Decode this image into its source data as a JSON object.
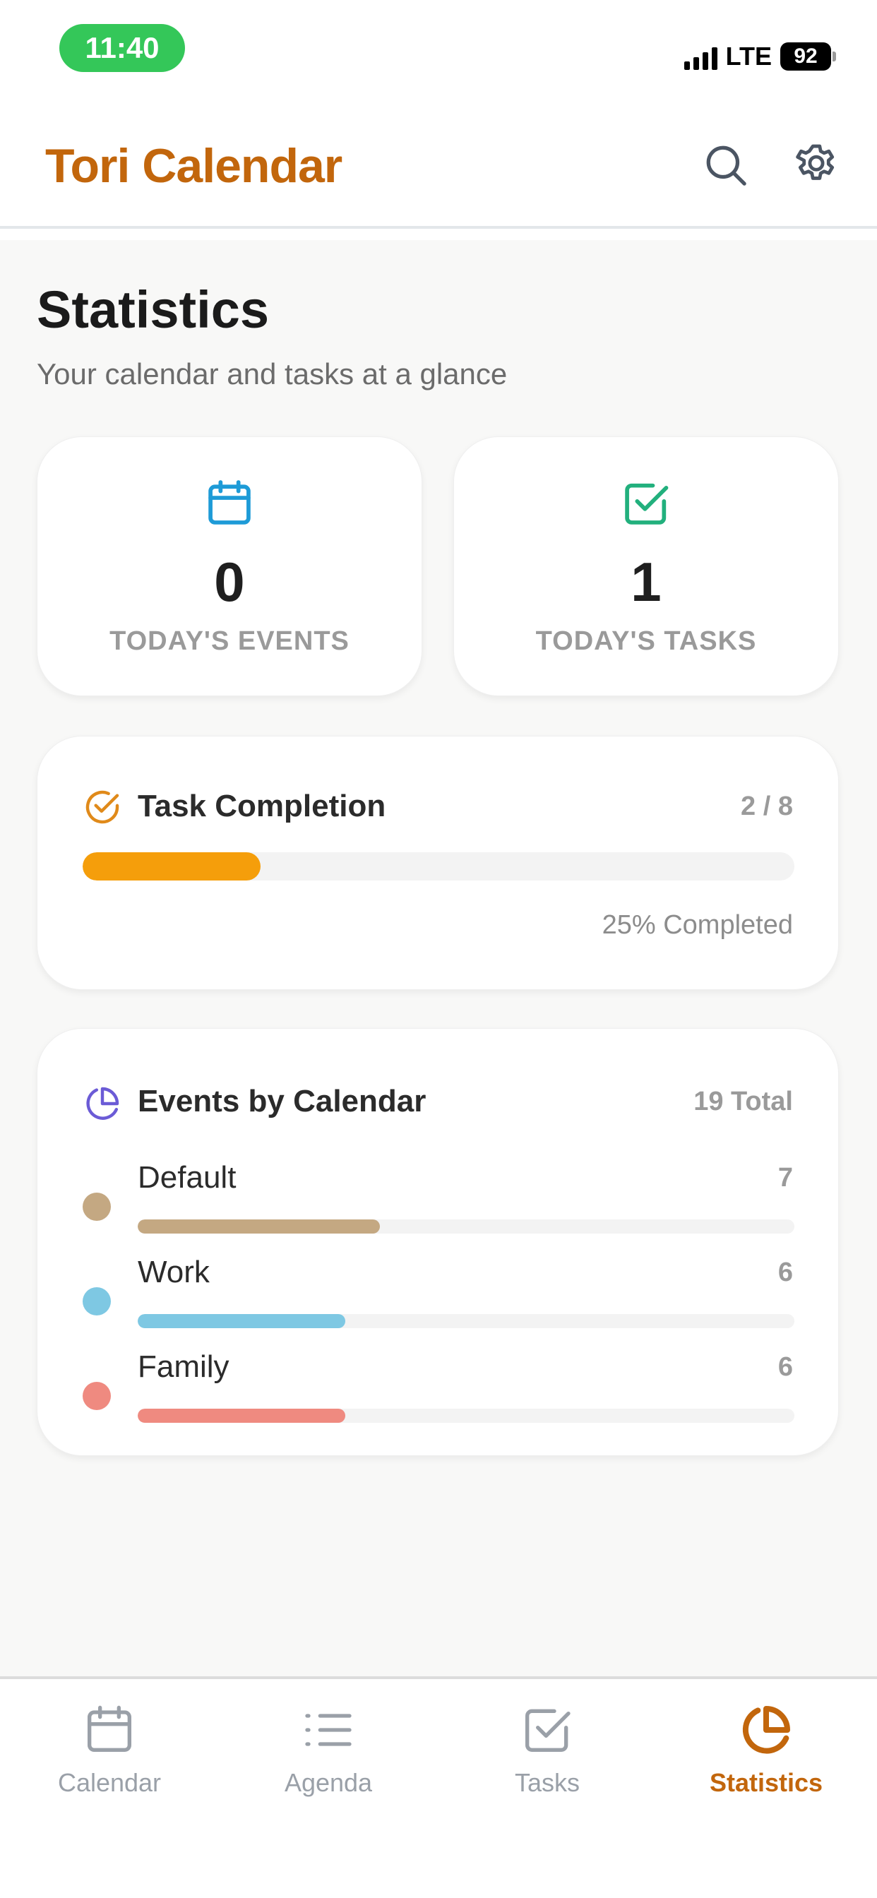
{
  "status_bar": {
    "time": "11:40",
    "network": "LTE",
    "battery": "92",
    "signal_bars": 4
  },
  "header": {
    "title": "Tori Calendar",
    "search_icon": "search-icon",
    "settings_icon": "gear-icon"
  },
  "page": {
    "title": "Statistics",
    "subtitle": "Your calendar and tasks at a glance"
  },
  "summary": {
    "events": {
      "value": "0",
      "label": "TODAY'S EVENTS",
      "icon": "calendar-icon",
      "color": "#1e9bd7"
    },
    "tasks": {
      "value": "1",
      "label": "TODAY'S TASKS",
      "icon": "checkbox-icon",
      "color": "#22b07d"
    }
  },
  "task_completion": {
    "title": "Task Completion",
    "count": "2 / 8",
    "completed_fraction": 0.25,
    "percent_text": "25% Completed",
    "bar_color": "#f59e0b",
    "icon": "check-circle-icon",
    "icon_color": "#e08a1a"
  },
  "events_by_calendar": {
    "title": "Events by Calendar",
    "total": "19 Total",
    "icon": "pie-chart-icon",
    "icon_color": "#6b5bd6",
    "max_count": 19,
    "items": [
      {
        "name": "Default",
        "count": "7",
        "value": 7,
        "color": "#c4a882"
      },
      {
        "name": "Work",
        "count": "6",
        "value": 6,
        "color": "#7ec8e3"
      },
      {
        "name": "Family",
        "count": "6",
        "value": 6,
        "color": "#ef8a80"
      }
    ]
  },
  "nav": {
    "items": [
      {
        "label": "Calendar",
        "icon": "calendar-icon",
        "active": false
      },
      {
        "label": "Agenda",
        "icon": "list-icon",
        "active": false
      },
      {
        "label": "Tasks",
        "icon": "checkbox-icon",
        "active": false
      },
      {
        "label": "Statistics",
        "icon": "pie-chart-icon",
        "active": true
      }
    ],
    "active_color": "#c2660c",
    "inactive_color": "#9aa0a8"
  }
}
